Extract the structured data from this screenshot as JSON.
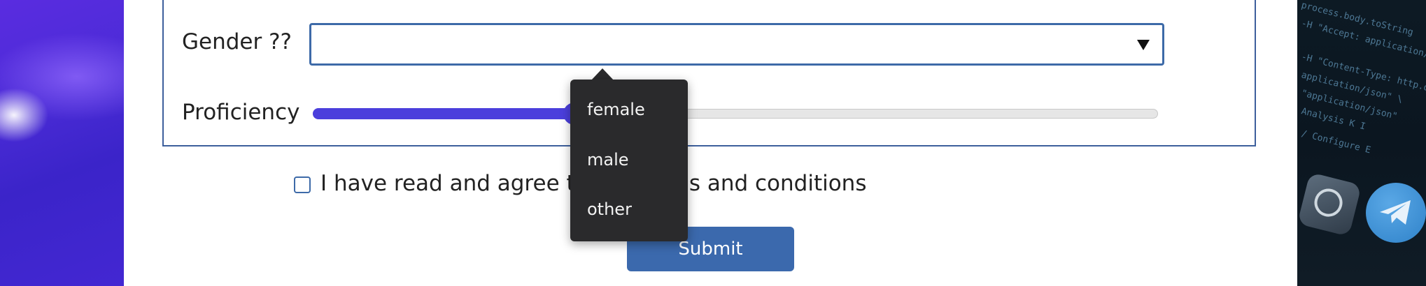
{
  "form": {
    "gender": {
      "label": "Gender ??",
      "selected_value": "",
      "options": [
        "female",
        "male",
        "other"
      ],
      "dropdown_open": true
    },
    "proficiency": {
      "label": "Proficiency",
      "value_fraction": 0.31
    },
    "terms": {
      "checked": false,
      "label": "I have read and agree to the terms and conditions"
    },
    "submit_label": "Submit"
  },
  "colors": {
    "accent": "#3b69ad",
    "slider": "#4b3fdc",
    "border": "#3d5f9c",
    "dropdown_bg": "#2a2a2c"
  },
  "icons": {
    "select_arrow": "triangle-down-icon",
    "telegram": "telegram-icon",
    "app_tile": "steering-wheel-icon"
  }
}
